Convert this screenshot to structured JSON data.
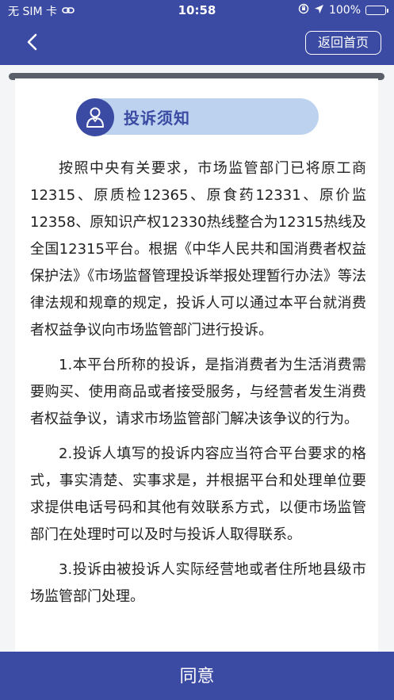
{
  "status_bar": {
    "carrier": "无 SIM 卡",
    "time": "10:58",
    "battery": "100%"
  },
  "nav": {
    "home_label": "返回首页"
  },
  "notice": {
    "title": "投诉须知",
    "paragraphs": [
      "按照中央有关要求，市场监管部门已将原工商12315、原质检12365、原食药12331、原价监12358、原知识产权12330热线整合为12315热线及全国12315平台。根据《中华人民共和国消费者权益保护法》《市场监督管理投诉举报处理暂行办法》等法律法规和规章的规定，投诉人可以通过本平台就消费者权益争议向市场监管部门进行投诉。",
      "1.本平台所称的投诉，是指消费者为生活消费需要购买、使用商品或者接受服务，与经营者发生消费者权益争议，请求市场监管部门解决该争议的行为。",
      "2.投诉人填写的投诉内容应当符合平台要求的格式，事实清楚、实事求是，并根据平台和处理单位要求提供电话号码和其他有效联系方式，以便市场监管部门在处理时可以及时与投诉人取得联系。",
      "3.投诉由被投诉人实际经营地或者住所地县级市场监管部门处理。"
    ]
  },
  "footer": {
    "agree_label": "同意"
  },
  "colors": {
    "primary": "#3b4aa3",
    "title_pill": "#bcd2ee",
    "text": "#222222"
  }
}
